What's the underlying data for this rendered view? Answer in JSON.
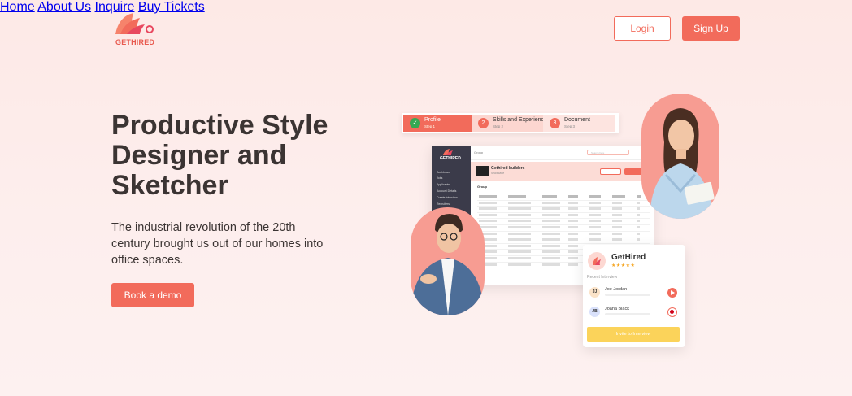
{
  "header": {
    "logo_text": "GETHIRED",
    "nav": [
      "Home",
      "About Us",
      "Inquire",
      "Buy Tickets"
    ],
    "login_label": "Login",
    "signup_label": "Sign Up"
  },
  "hero": {
    "title": "Productive Style Designer and Sketcher",
    "description": "The industrial revolution of the 20th century brought us out of our homes into office spaces.",
    "cta_label": "Book a demo"
  },
  "stepper": {
    "steps": [
      {
        "title": "Profile",
        "sub": "Step 1"
      },
      {
        "title": "Skills and Experience",
        "sub": "Step 2"
      },
      {
        "title": "Document",
        "sub": "Step 3"
      }
    ]
  },
  "dashboard": {
    "logo_text": "GETHIRED",
    "crumb": "Group",
    "search": "Search here",
    "banner_title": "Gethired builders",
    "banner_sub": "Showcase",
    "sidebar": [
      "Dashboard",
      "Jobs",
      "Applicants",
      "Account Details",
      "Create Interview",
      "Recruiters"
    ],
    "section": "Group"
  },
  "card": {
    "title": "GetHired",
    "stars": "★★★★★",
    "subtitle": "Recent Interview",
    "rows": [
      {
        "initials": "JJ",
        "name": "Joe Jordan",
        "av_color": "#fbe3c8"
      },
      {
        "initials": "JB",
        "name": "Joana Black",
        "av_color": "#d9e1fb"
      }
    ],
    "button": "Invite to Interview"
  },
  "colors": {
    "accent": "#f26b5b",
    "brand_yellow": "#fbd35a"
  }
}
